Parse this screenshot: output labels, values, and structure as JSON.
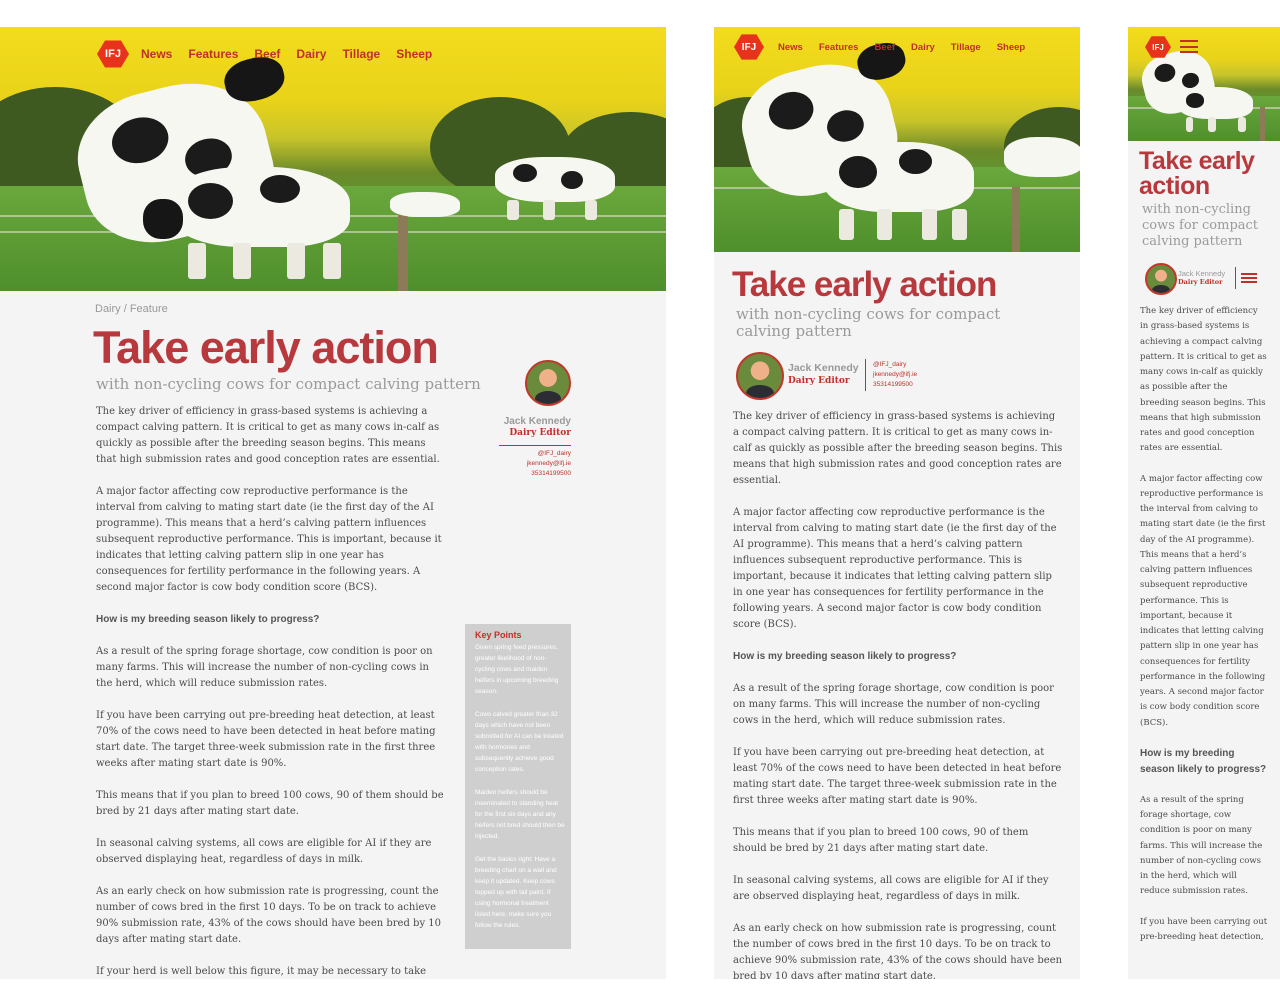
{
  "nav": {
    "logo": "IFJ",
    "items": [
      "News",
      "Features",
      "Beef",
      "Dairy",
      "Tillage",
      "Sheep"
    ]
  },
  "article": {
    "breadcrumb": "Dairy / Feature",
    "title": "Take early action",
    "subtitle": "with non-cycling cows for compact calving pattern",
    "subtitle_line1": "with non-cycling cows for compact",
    "subtitle_line2": "calving pattern",
    "mobile_title_line1": "Take early",
    "mobile_title_line2": "action",
    "mobile_subtitle_line1": "with non-cycling",
    "mobile_subtitle_line2": "cows for compact",
    "mobile_subtitle_line3": "calving pattern",
    "author": {
      "name": "Jack Kennedy",
      "role": "Dairy Editor",
      "twitter": "@IFJ_dairy",
      "email": "jkennedy@ifj.ie",
      "phone": "35314199500"
    },
    "paragraphs": [
      "The key driver of efficiency in grass-based systems is achieving a compact calving pattern. It is critical to get as many cows in-calf as quickly as possible after the breeding season begins. This means that high submission rates and good conception rates are essential.",
      "A major factor affecting cow reproductive performance is the interval from calving to mating start date (ie the first day of the AI programme). This means that a herd’s calving pattern influences subsequent reproductive performance. This is important, because it indicates that letting calving pattern slip in one year has consequences for fertility performance in the following years. A second major factor is cow body condition score (BCS).",
      "As a result of the spring forage shortage, cow condition is poor on many farms. This will increase the number of non-cycling cows in the herd, which will reduce submission rates.",
      "If you have been carrying out pre-breeding heat detection, at least 70% of the cows need to have been detected in heat before mating start date. The target three-week submission rate in the first three weeks after mating start date is 90%.",
      "This means that if you plan to breed 100 cows, 90 of them should be bred by 21 days after mating start date.",
      "In seasonal calving systems, all cows are eligible for AI if they are observed displaying heat, regardless of days in milk.",
      "As an early check on how submission rate is progressing, count the number of cows bred in the first 10 days. To be on track to achieve 90% submission rate, 43% of the cows should have been bred by 10 days after mating start date.",
      "If your herd is well below this figure, it may be necessary to take early action to prevent a slippage in calving pattern."
    ],
    "heading": "How is my breeding season likely to progress?",
    "mobile_last_text": "If you have been carrying out pre-breeding heat detection,",
    "key_points": {
      "title": "Key Points",
      "items": [
        "Given spring feed pressures, greater likelihood of non-cycling cows and maiden heifers in upcoming breeding season.",
        "Cows calved greater than 32 days which have not been submitted for AI can be treated with hormones and subsequently achieve good conception rates.",
        "Maiden heifers should be inseminated to standing heat for the first six days and any heifers not bred should then be injected.",
        "Get the basics right: Have a breeding chart on a wall and keep it updated. Keep cows topped up with tail paint. If using hormonal treatment listed here, make sure you follow the rules."
      ]
    }
  },
  "colors": {
    "accent": "#b8393d",
    "nav_red": "#c0302a",
    "logo_bg": "#e8331c",
    "panel_bg": "#f4f4f4",
    "keypoints_bg": "#cfcfcf"
  }
}
